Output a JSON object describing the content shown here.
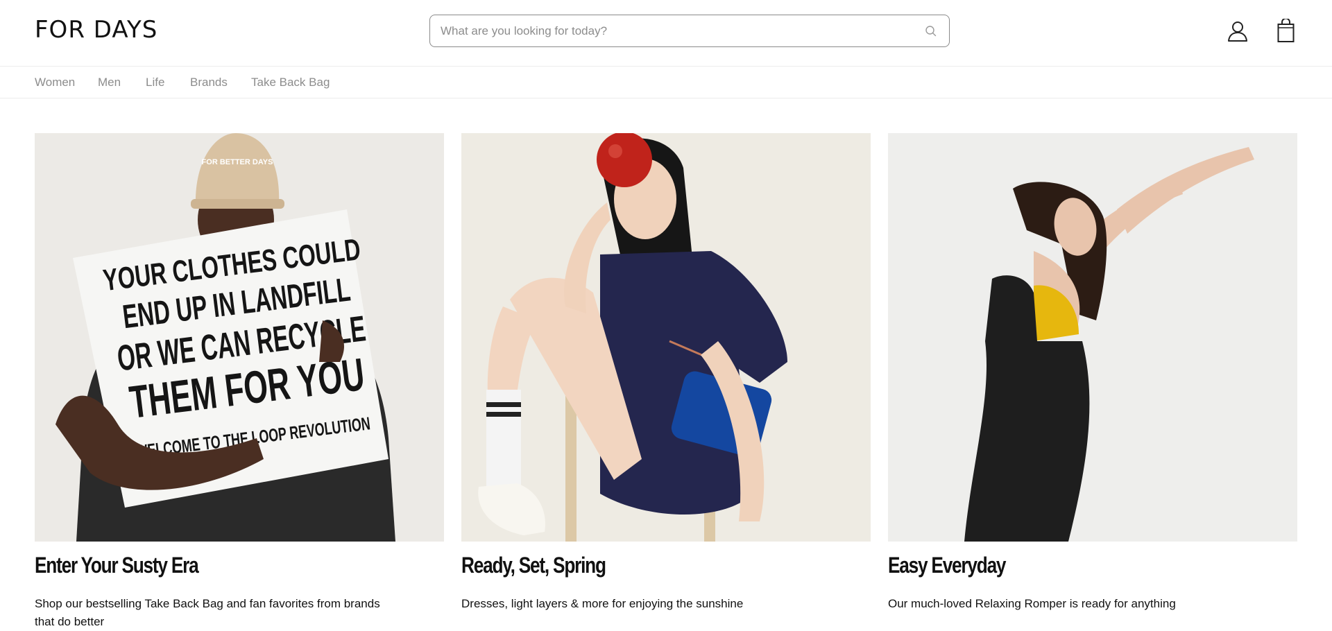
{
  "header": {
    "logo": "FOR DAYS",
    "search": {
      "placeholder": "What are you looking for today?",
      "value": ""
    },
    "icons": [
      "search-icon",
      "account-icon",
      "shopping-bag-icon"
    ]
  },
  "nav": {
    "items": [
      "Women",
      "Men",
      "Life",
      "Brands",
      "Take Back Bag"
    ]
  },
  "cards": [
    {
      "title": "Enter Your Susty Era",
      "description": "Shop our bestselling Take Back Bag and fan favorites from brands that do better",
      "image_text": [
        "YOUR CLOTHES COULD",
        "END UP IN LANDFILL",
        "OR WE CAN RECYCLE",
        "THEM FOR YOU",
        "WELCOME TO THE LOOP REVOLUTION"
      ],
      "cap_text": "FOR BETTER DAYS"
    },
    {
      "title": "Ready, Set, Spring",
      "description": "Dresses, light layers & more for enjoying the sunshine"
    },
    {
      "title": "Easy Everyday",
      "description": "Our much-loved Relaxing Romper is ready for anything"
    }
  ],
  "colors": {
    "border": "#8a8a8a",
    "nav_text": "#8c8c8c",
    "image_bg": "#ececea"
  }
}
